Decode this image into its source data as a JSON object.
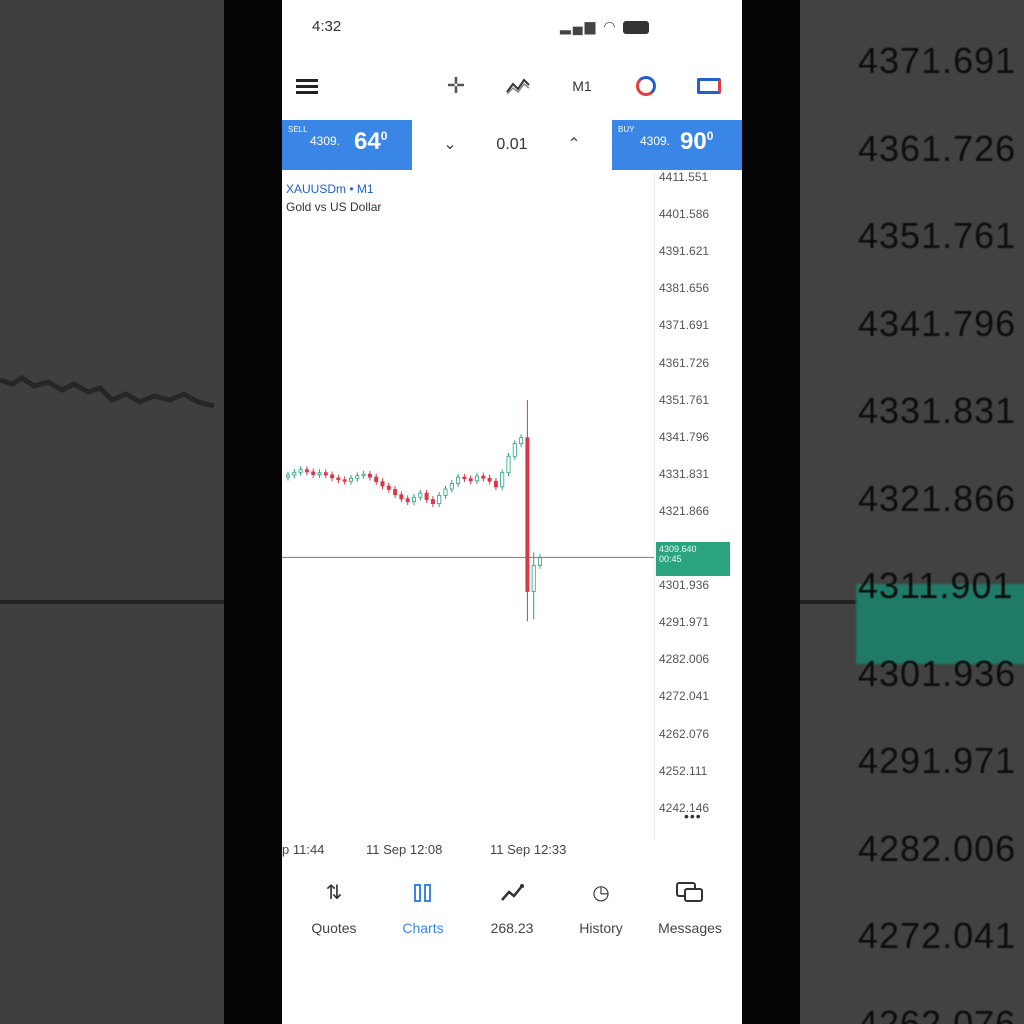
{
  "status_bar": {
    "time": "4:32",
    "indicators": "signal wifi battery"
  },
  "toolbar": {
    "menu_icon": "menu-icon",
    "crosshair_icon": "crosshair-icon",
    "indicators_icon": "indicators-icon",
    "timeframe": "M1",
    "cycle_icon": "objects-icon",
    "trade_icon": "trade-icon"
  },
  "trade": {
    "sell": {
      "label": "SELL",
      "price_prefix": "4309.",
      "price_big": "64",
      "price_sup": "0"
    },
    "buy": {
      "label": "BUY",
      "price_prefix": "4309.",
      "price_big": "90",
      "price_sup": "0"
    },
    "lot": "0.01"
  },
  "chart": {
    "symbol": "XAUUSDm • M1",
    "description": "Gold vs US Dollar",
    "price_ticks": [
      "4411.551",
      "4401.586",
      "4391.621",
      "4381.656",
      "4371.691",
      "4361.726",
      "4351.761",
      "4341.796",
      "4331.831",
      "4321.866",
      "4311.901",
      "4301.936",
      "4291.971",
      "4282.006",
      "4272.041",
      "4262.076",
      "4252.111",
      "4242.146"
    ],
    "current_price": "4309.640",
    "current_timer": "00:45",
    "time_labels": [
      "p 11:44",
      "11 Sep 12:08",
      "11 Sep 12:33"
    ],
    "bid_line_color": "#8a8a8a",
    "up_color": "#2aa37f",
    "down_color": "#d9384a"
  },
  "chart_data": {
    "type": "candlestick",
    "symbol": "XAUUSDm",
    "timeframe": "M1",
    "ylim": [
      4242.146,
      4416
    ],
    "close_series": [
      4331.8,
      4332.5,
      4333.2,
      4332.6,
      4331.9,
      4332.4,
      4331.8,
      4331.0,
      4330.5,
      4330.1,
      4330.9,
      4331.6,
      4332.0,
      4331.2,
      4330.0,
      4328.8,
      4327.9,
      4326.5,
      4325.4,
      4324.6,
      4325.8,
      4326.9,
      4325.2,
      4324.1,
      4326.3,
      4328.0,
      4329.5,
      4331.2,
      4330.8,
      4330.2,
      4331.5,
      4330.9,
      4330.1,
      4328.6,
      4332.4,
      4336.8,
      4340.2,
      4341.8,
      4300.5,
      4307.5,
      4309.6
    ],
    "last_price": 4309.64
  },
  "background": {
    "zoom_ticks": [
      "4371.691",
      "4361.726",
      "4351.761",
      "4341.796",
      "4331.831",
      "4321.866",
      "4311.901",
      "4301.936",
      "4291.971",
      "4282.006",
      "4272.041",
      "4262.076"
    ],
    "zoom_badge": "4309.640 00:45"
  },
  "tabs": [
    {
      "label": "Quotes",
      "icon": "quotes-icon",
      "active": false
    },
    {
      "label": "Charts",
      "icon": "charts-icon",
      "active": true
    },
    {
      "label": "268.23",
      "icon": "trade-tab-icon",
      "active": false
    },
    {
      "label": "History",
      "icon": "history-icon",
      "active": false
    },
    {
      "label": "Messages",
      "icon": "messages-icon",
      "active": false
    }
  ]
}
